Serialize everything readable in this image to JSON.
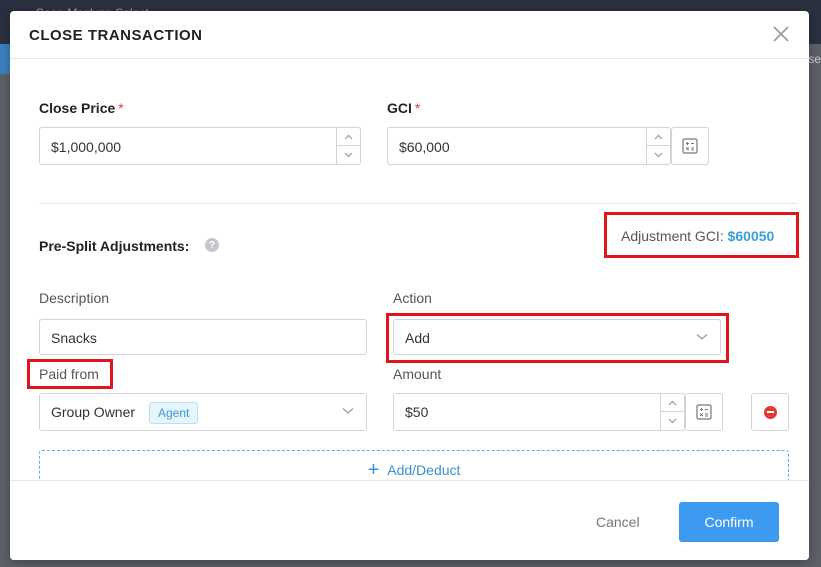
{
  "background": {
    "top_text": "Sean Mcglynn Select",
    "right_text": "se"
  },
  "modal": {
    "title": "CLOSE TRANSACTION",
    "close_icon": "close-icon"
  },
  "close_price": {
    "label": "Close Price",
    "required_mark": "*",
    "value": "$1,000,000"
  },
  "gci": {
    "label": "GCI",
    "required_mark": "*",
    "value": "$60,000"
  },
  "pre_split": {
    "title": "Pre-Split Adjustments:",
    "help_icon": "?",
    "adjustment_label": "Adjustment GCI:",
    "adjustment_value": "$60050"
  },
  "adjustment_row": {
    "description_label": "Description",
    "description_value": "Snacks",
    "action_label": "Action",
    "action_value": "Add",
    "paid_from_label": "Paid from",
    "paid_from_value": "Group Owner",
    "paid_from_tag": "Agent",
    "amount_label": "Amount",
    "amount_value": "$50"
  },
  "add_deduct": {
    "plus": "+",
    "label": "Add/Deduct"
  },
  "footer": {
    "cancel_label": "Cancel",
    "confirm_label": "Confirm"
  },
  "colors": {
    "accent": "#3c9af0",
    "highlight_box": "#e0141b",
    "adjustment_value": "#3f9ed8",
    "required": "#e53935"
  }
}
